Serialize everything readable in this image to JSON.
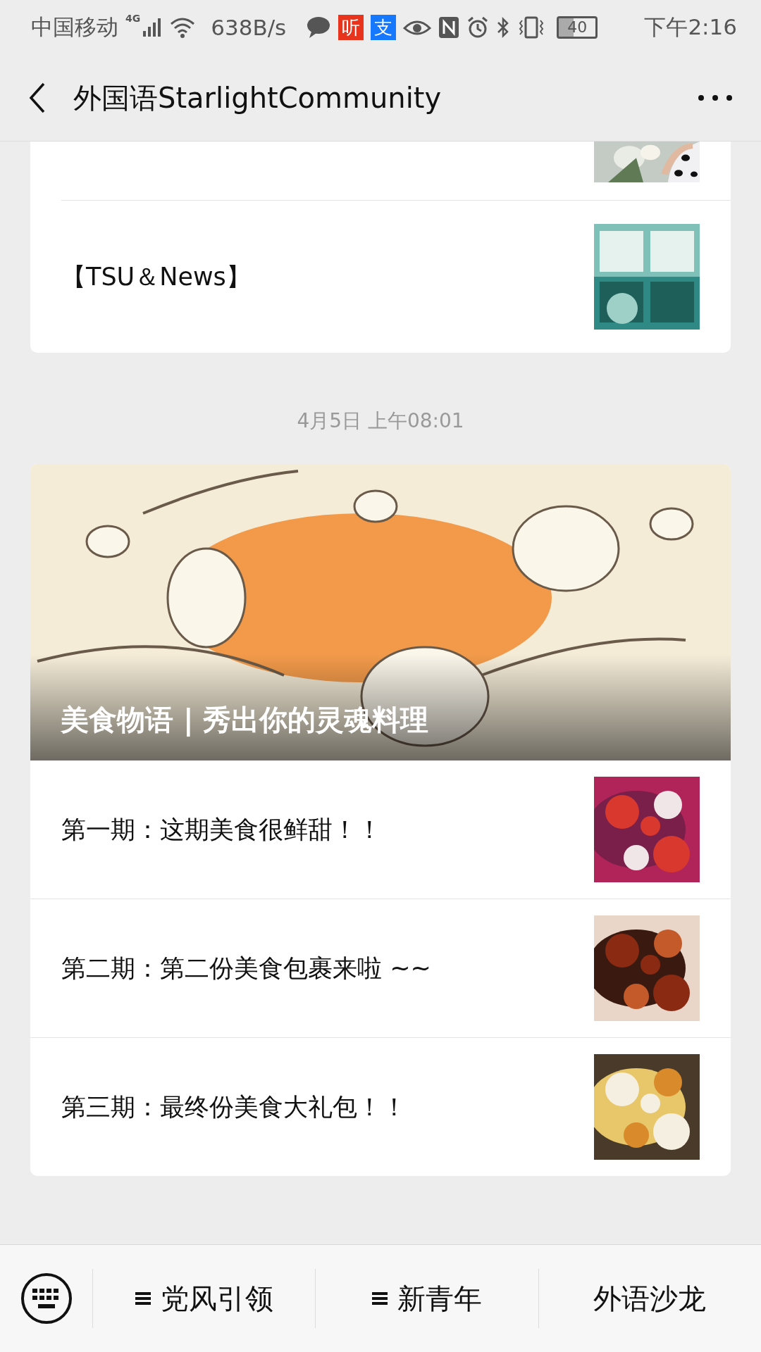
{
  "status_bar": {
    "carrier": "中国移动",
    "network": "4G",
    "speed": "638B/s",
    "app_badges": [
      {
        "label": "听",
        "color": "#e8341c"
      },
      {
        "label": "支",
        "color": "#1677ff"
      }
    ],
    "battery": "40",
    "time": "下午2:16"
  },
  "header": {
    "title": "外国语StarlightCommunity"
  },
  "first_card": {
    "rows": [
      {
        "title": "【TSU＆News】"
      }
    ]
  },
  "timestamp": "4月5日 上午08:01",
  "second_card": {
    "cover": {
      "kind": "picture",
      "title": "美食物语 | 秀出你的灵魂料理"
    },
    "rows": [
      {
        "title": "第一期：这期美食很鲜甜！！"
      },
      {
        "title": "第二期：第二份美食包裹来啦 ~~"
      },
      {
        "title": "第三期：最终份美食大礼包！！"
      }
    ]
  },
  "bottom_menu": [
    {
      "label": "党风引领",
      "submenu": true
    },
    {
      "label": "新青年",
      "submenu": true
    },
    {
      "label": "外语沙龙",
      "submenu": false
    }
  ]
}
